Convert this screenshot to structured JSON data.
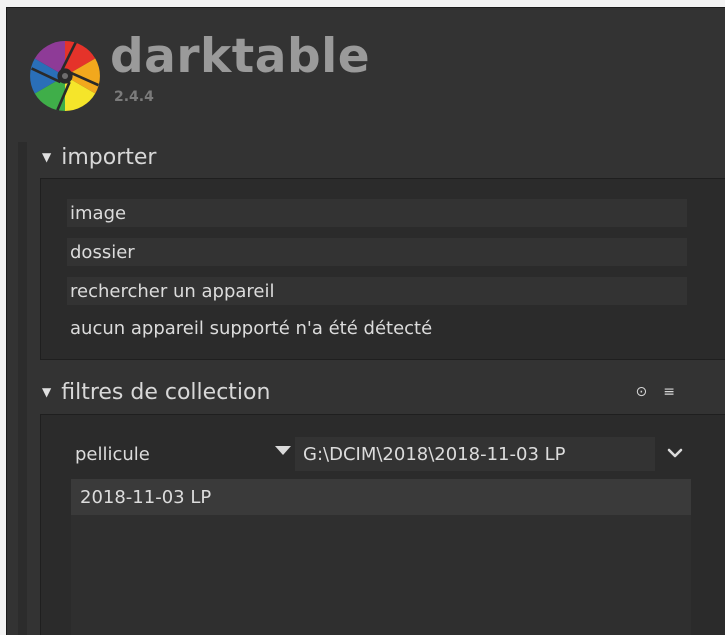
{
  "brand": {
    "name": "darktable",
    "version": "2.4.4"
  },
  "importer": {
    "title": "importer",
    "arrow": "▼",
    "buttons": [
      {
        "label": "image"
      },
      {
        "label": "dossier"
      },
      {
        "label": "rechercher un appareil"
      }
    ],
    "status": "aucun appareil supporté n'a été détecté"
  },
  "collection": {
    "title": "filtres de collection",
    "arrow": "▼",
    "tool_icons": [
      "info-icon",
      "menu-icon"
    ],
    "tool_glyphs": [
      "⊙",
      "≡"
    ],
    "property": "pellicule",
    "path": "G:\\DCIM\\2018\\2018-11-03 LP",
    "results": [
      "2018-11-03 LP"
    ]
  },
  "colors": {
    "background": "#333333",
    "panel": "#2b2b2b",
    "text": "#dcdcdc",
    "logo_text": "#9a9a9a"
  }
}
